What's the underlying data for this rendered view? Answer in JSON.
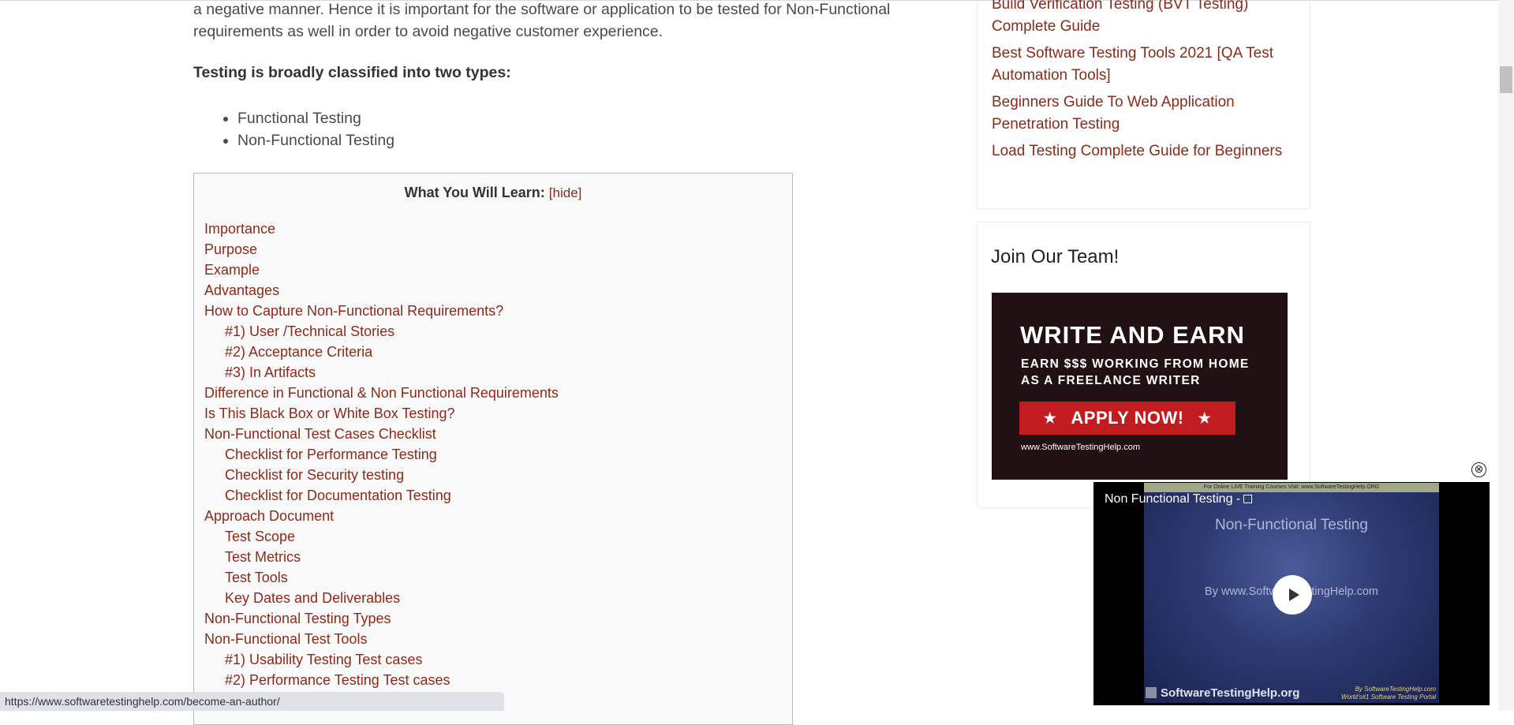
{
  "article": {
    "intro": "a negative manner. Hence it is important for the software or application to be tested for Non-Functional requirements as well in order to avoid negative customer experience.",
    "classified": "Testing is broadly classified into two types:",
    "types": [
      "Functional Testing",
      "Non-Functional Testing"
    ]
  },
  "toc": {
    "title": "What You Will Learn:",
    "hide": "[hide]",
    "items": [
      {
        "label": "Importance",
        "sub": false
      },
      {
        "label": "Purpose",
        "sub": false
      },
      {
        "label": "Example",
        "sub": false
      },
      {
        "label": "Advantages",
        "sub": false
      },
      {
        "label": "How to Capture Non-Functional Requirements?",
        "sub": false
      },
      {
        "label": "#1) User /Technical Stories",
        "sub": true
      },
      {
        "label": "#2) Acceptance Criteria",
        "sub": true
      },
      {
        "label": "#3) In Artifacts",
        "sub": true
      },
      {
        "label": "Difference in Functional & Non Functional Requirements",
        "sub": false
      },
      {
        "label": "Is This Black Box or White Box Testing?",
        "sub": false
      },
      {
        "label": "Non-Functional Test Cases Checklist",
        "sub": false
      },
      {
        "label": "Checklist for Performance Testing",
        "sub": true
      },
      {
        "label": "Checklist for Security testing",
        "sub": true
      },
      {
        "label": "Checklist for Documentation Testing",
        "sub": true
      },
      {
        "label": "Approach Document",
        "sub": false
      },
      {
        "label": "Test Scope",
        "sub": true
      },
      {
        "label": "Test Metrics",
        "sub": true
      },
      {
        "label": "Test Tools",
        "sub": true
      },
      {
        "label": "Key Dates and Deliverables",
        "sub": true
      },
      {
        "label": "Non-Functional Testing Types",
        "sub": false
      },
      {
        "label": "Non-Functional Test Tools",
        "sub": false
      },
      {
        "label": "#1) Usability Testing Test cases",
        "sub": true
      },
      {
        "label": "#2) Performance Testing Test cases",
        "sub": true
      }
    ]
  },
  "sidebar": {
    "links": [
      "Build Verification Testing (BVT Testing) Complete Guide",
      "Best Software Testing Tools 2021 [QA Test Automation Tools]",
      "Beginners Guide To Web Application Penetration Testing",
      "Load Testing Complete Guide for Beginners"
    ],
    "join_title": "Join Our Team!",
    "banner": {
      "headline": "WRITE AND EARN",
      "line1": "EARN $$$ WORKING FROM HOME",
      "line2": "AS A FREELANCE WRITER",
      "button": "APPLY NOW!",
      "url": "www.SoftwareTestingHelp.com"
    }
  },
  "video": {
    "close_icon": "⊗",
    "strip": "For Online LIVE Training Courses Visit: www.SoftwareTestingHelp.ORG",
    "title": "Non Functional Testing -",
    "slide_title": "Non-Functional Testing",
    "slide_sub": "By www.SoftwareTestingHelp.com",
    "brand": "SoftwareTestingHelp.org",
    "by_line1": "By SoftwareTestingHelp.com",
    "by_line2": "World's#1 Software Testing Portal"
  },
  "status_url": "https://www.softwaretestinghelp.com/become-an-author/"
}
